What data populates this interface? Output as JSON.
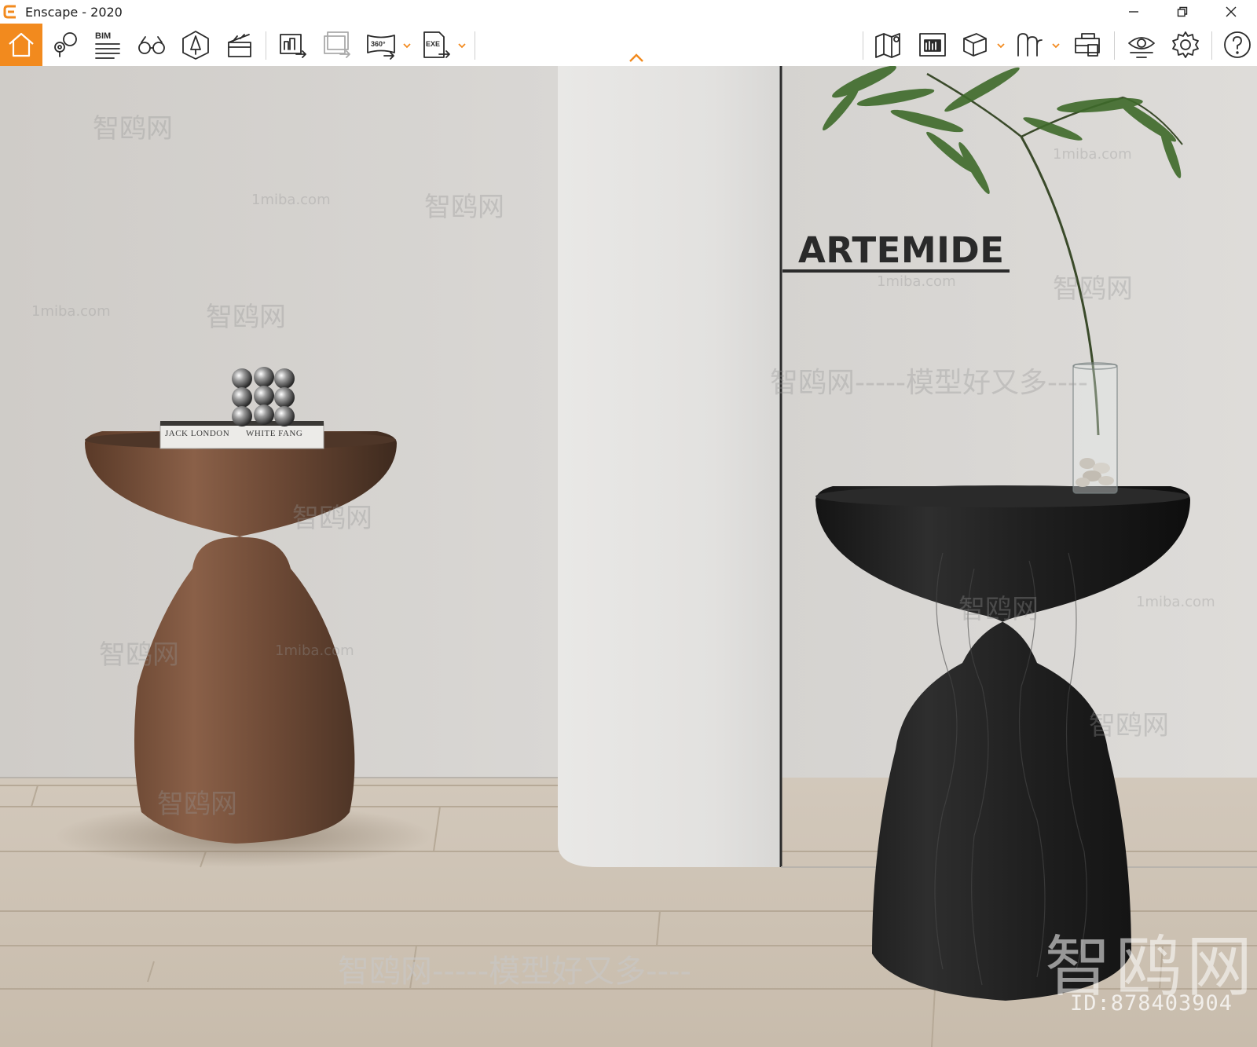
{
  "window": {
    "title": "Enscape - 2020",
    "controls": {
      "minimize": "minimize-icon",
      "restore": "restore-icon",
      "close": "close-icon"
    }
  },
  "toolbar": {
    "accent_color": "#f28a1e",
    "left_tools": [
      {
        "name": "home",
        "icon": "home-icon",
        "active": true
      },
      {
        "name": "views",
        "icon": "map-pin-icon"
      },
      {
        "name": "bim",
        "icon": "bim-info-icon",
        "label": "BIM"
      },
      {
        "name": "walk-mode",
        "icon": "binoculars-icon"
      },
      {
        "name": "assets",
        "icon": "asset-library-icon"
      },
      {
        "name": "video-editor",
        "icon": "clapperboard-icon"
      }
    ],
    "export_tools": [
      {
        "name": "render-image",
        "icon": "export-image-icon"
      },
      {
        "name": "batch-render",
        "icon": "batch-render-icon"
      },
      {
        "name": "panorama",
        "icon": "panorama-360-icon",
        "label": "360°",
        "has_dropdown": true
      },
      {
        "name": "exe-export",
        "icon": "export-exe-icon",
        "label": "EXE",
        "has_dropdown": true
      }
    ],
    "right_tools": [
      {
        "name": "map",
        "icon": "map-icon"
      },
      {
        "name": "mini-map",
        "icon": "minimap-icon"
      },
      {
        "name": "view-cube",
        "icon": "cube-icon",
        "has_dropdown": true
      },
      {
        "name": "views-library",
        "icon": "views-icon",
        "has_dropdown": true
      },
      {
        "name": "capture",
        "icon": "capture-icon"
      },
      {
        "name": "visual-settings",
        "icon": "eye-settings-icon"
      },
      {
        "name": "settings",
        "icon": "gear-icon"
      },
      {
        "name": "help",
        "icon": "help-icon"
      }
    ],
    "collapse": "chevron-up-icon"
  },
  "scene": {
    "brand_text": "ARTEMIDE",
    "book_left": "JACK LONDON",
    "book_right": "WHITE FANG",
    "colors": {
      "wall": "#d6d4d1",
      "column": "#e4e3e1",
      "floor": "#cbbfae",
      "table_left": "#6b4632",
      "table_right": "#1f1f1f"
    }
  },
  "watermarks": {
    "main": "智鸥网",
    "slogan": "智鸥网-----模型好又多----",
    "site": "1miba.com",
    "id_label": "ID:878403904"
  }
}
